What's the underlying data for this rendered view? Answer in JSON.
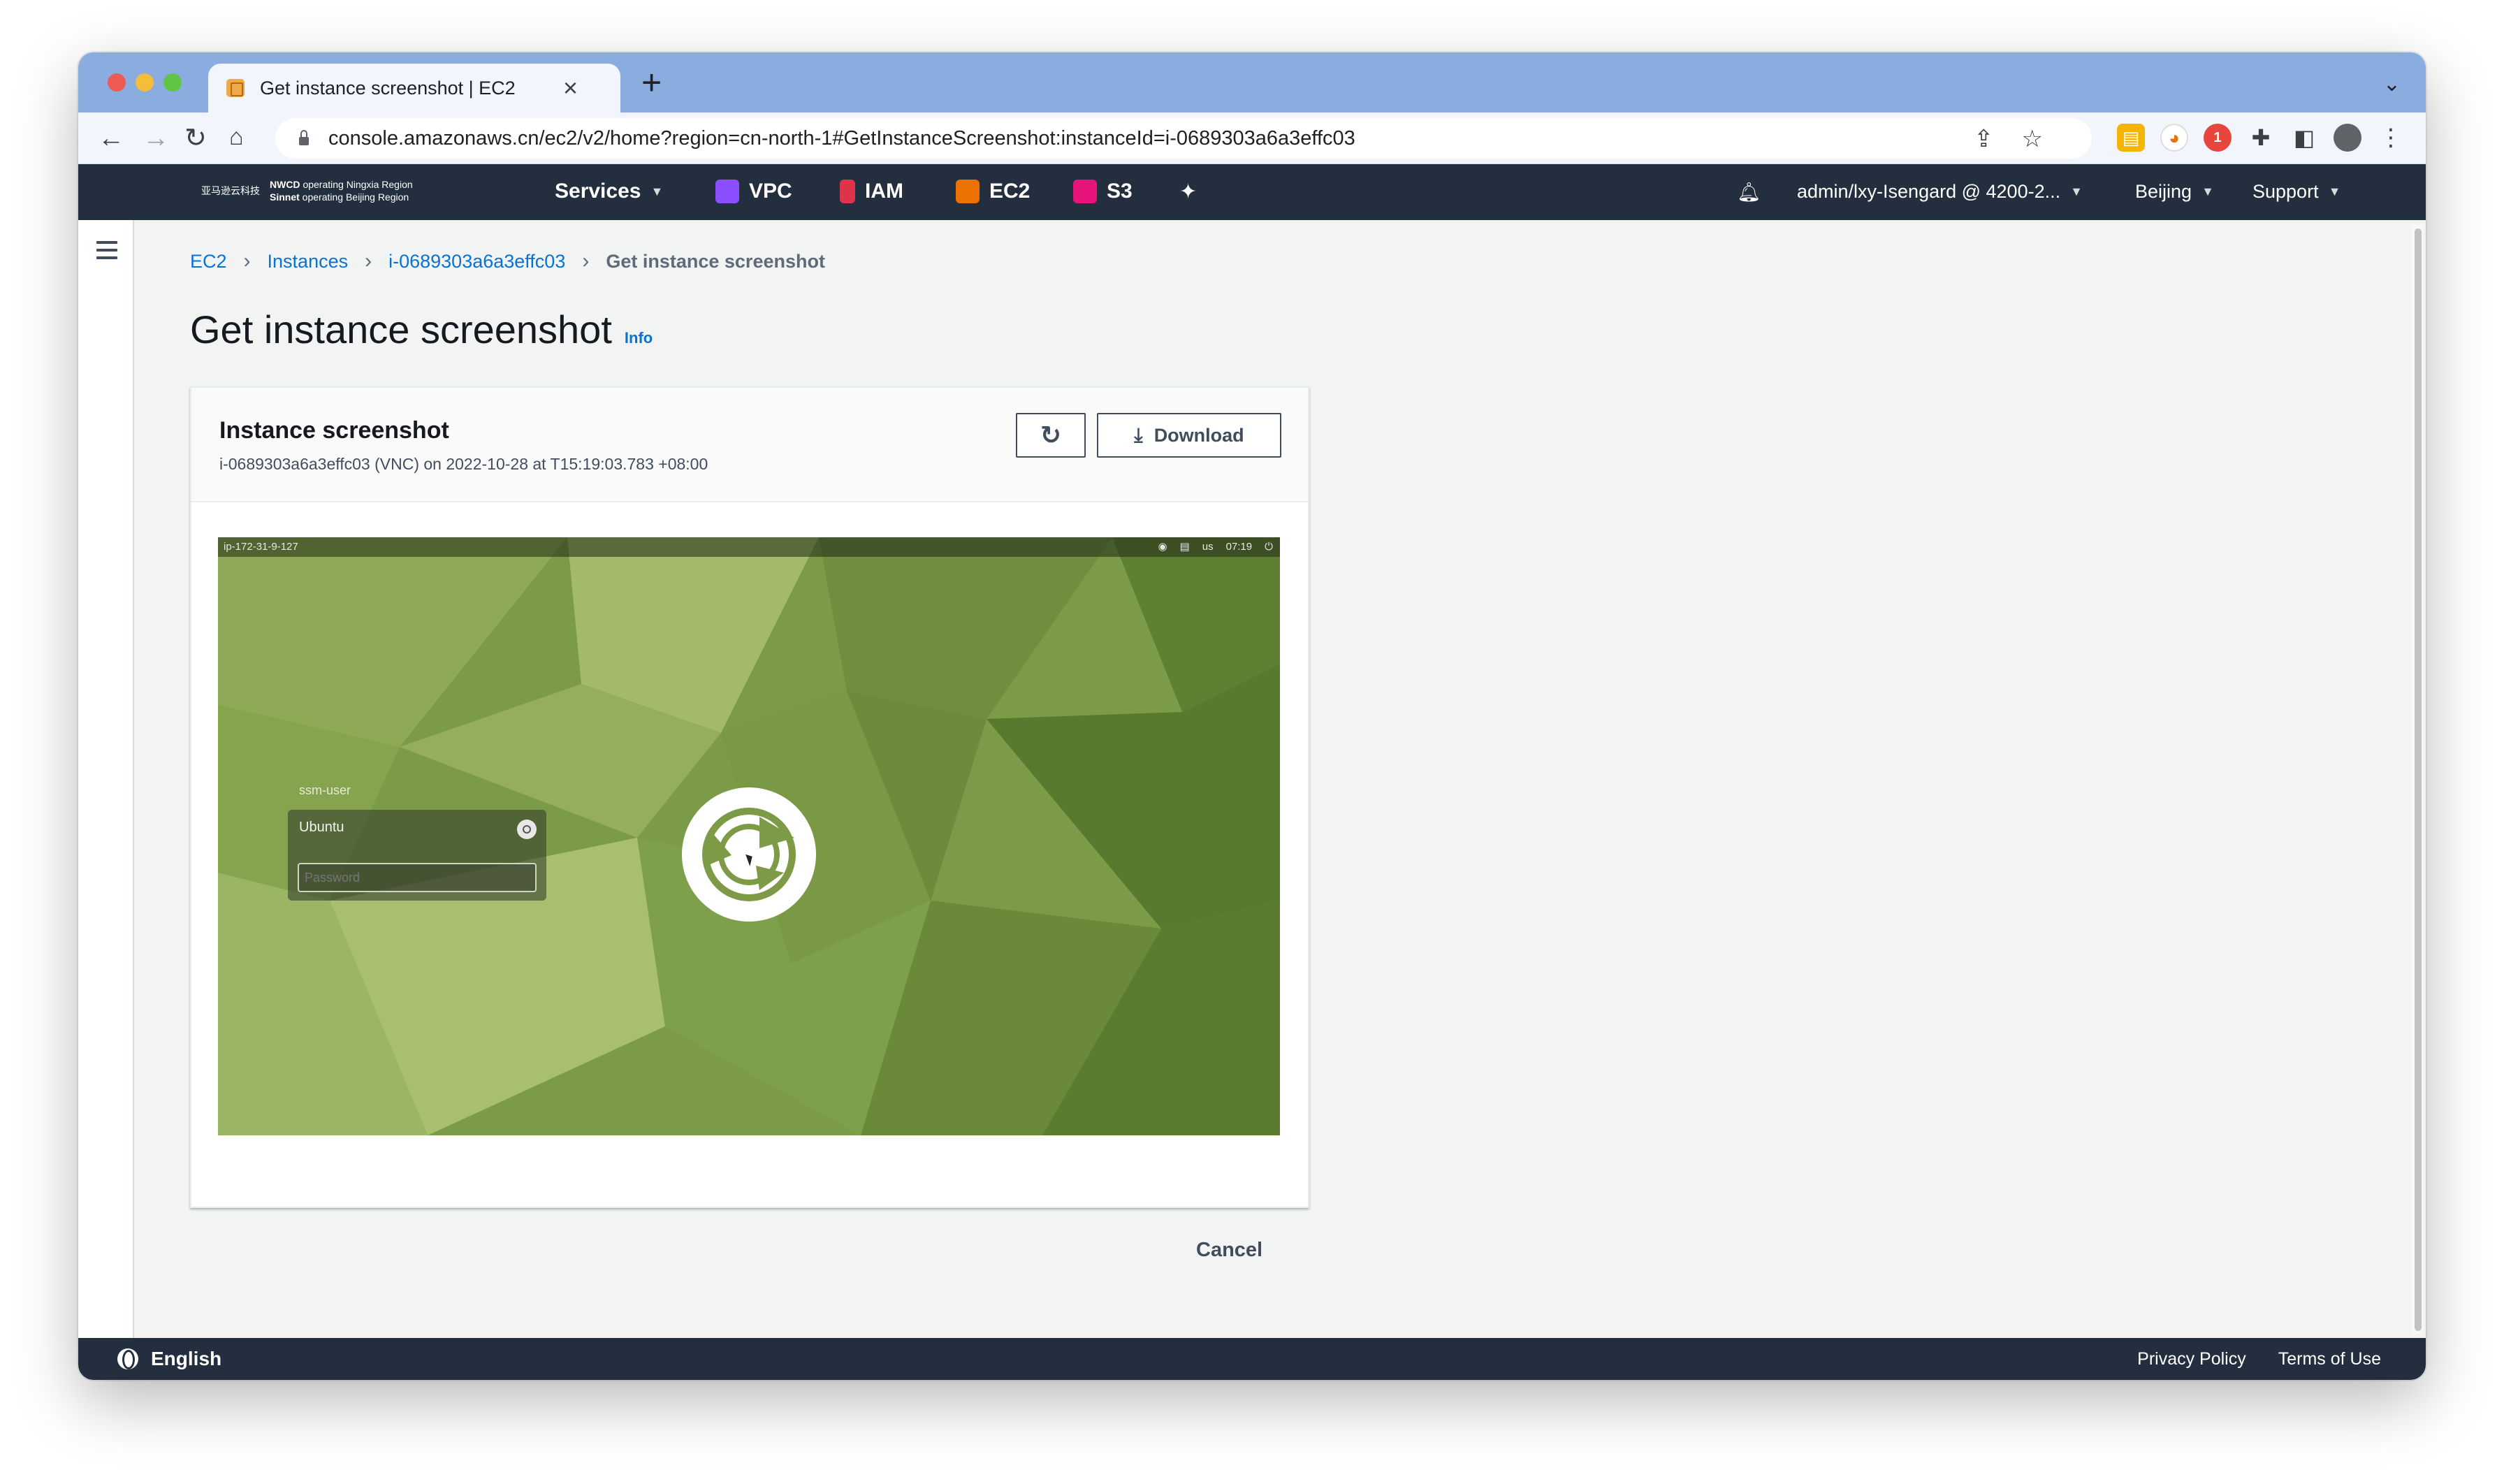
{
  "browser": {
    "tab_title": "Get instance screenshot | EC2",
    "tab_close": "×",
    "new_tab": "+",
    "url": "console.amazonaws.cn/ec2/v2/home?region=cn-north-1#GetInstanceScreenshot:instanceId=i-0689303a6a3effc03",
    "extension_badge": "1"
  },
  "aws_nav": {
    "brand_cn": "亚马逊云科技",
    "brand_line1_bold": "NWCD",
    "brand_line1_rest": "operating Ningxia Region",
    "brand_line2_bold": "Sinnet",
    "brand_line2_rest": "operating Beijing Region",
    "services_label": "Services",
    "shortcuts": [
      {
        "label": "VPC",
        "color": "#8c4fff"
      },
      {
        "label": "IAM",
        "color": "#dd344c"
      },
      {
        "label": "EC2",
        "color": "#ed7100"
      },
      {
        "label": "S3",
        "color": "#e7157b"
      }
    ],
    "account_label": "admin/lxy-Isengard @ 4200-2...",
    "region_label": "Beijing",
    "support_label": "Support"
  },
  "breadcrumb": {
    "items": [
      "EC2",
      "Instances",
      "i-0689303a6a3effc03"
    ],
    "current": "Get instance screenshot"
  },
  "page": {
    "title": "Get instance screenshot",
    "info_label": "Info"
  },
  "panel": {
    "title": "Instance screenshot",
    "subtitle": "i-0689303a6a3effc03 (VNC) on 2022-10-28 at T15:19:03.783 +08:00",
    "download_label": "Download"
  },
  "vm_screen": {
    "hostname": "ip-172-31-9-127",
    "keyboard": "us",
    "clock": "07:19",
    "username": "ssm-user",
    "session": "Ubuntu",
    "password_placeholder": "Password"
  },
  "actions": {
    "cancel_label": "Cancel"
  },
  "footer": {
    "language": "English",
    "privacy": "Privacy Policy",
    "terms": "Terms of Use"
  }
}
